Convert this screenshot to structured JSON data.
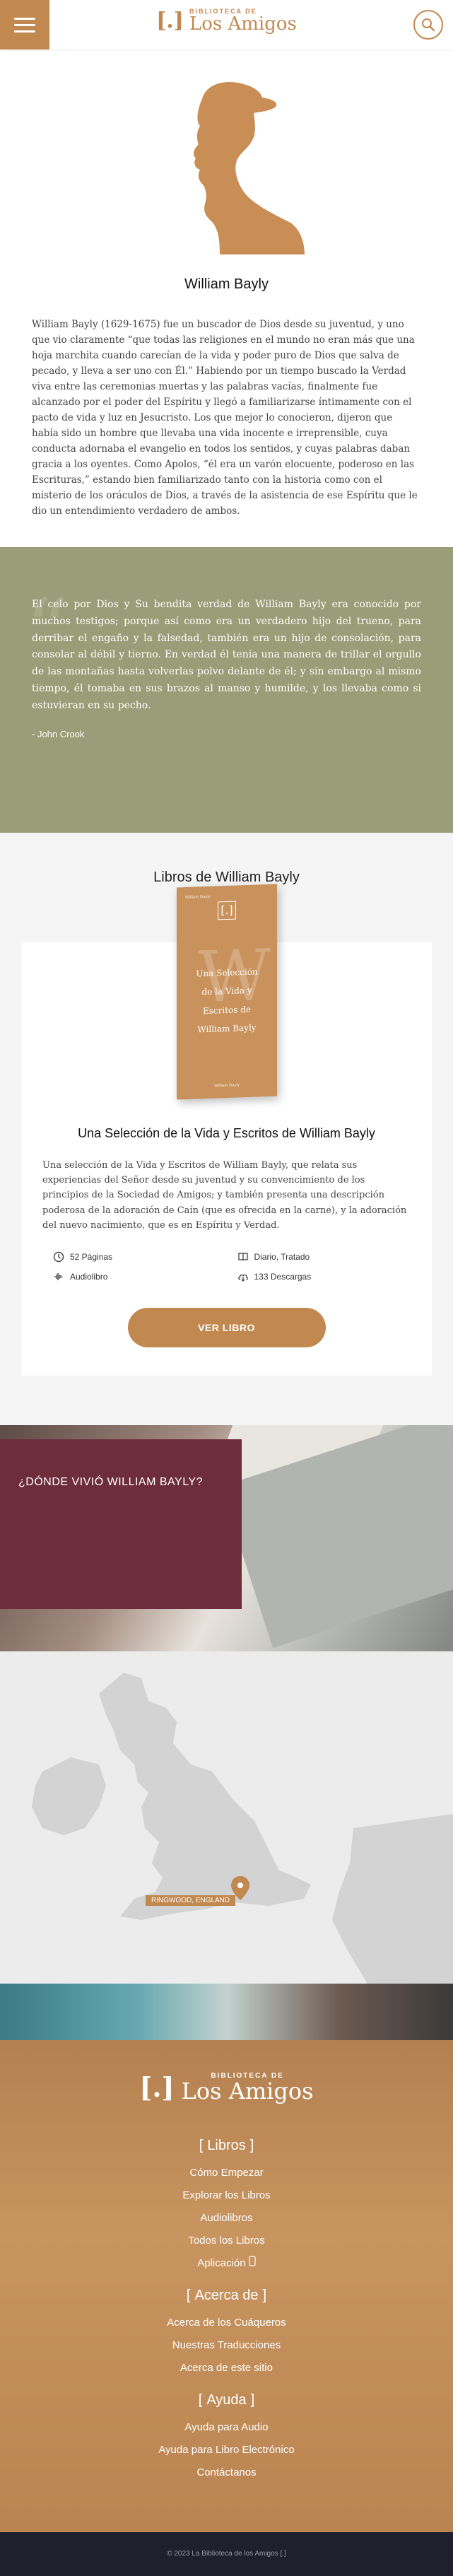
{
  "header": {
    "logo_small": "BIBLIOTECA DE",
    "logo_big": "Los Amigos",
    "logo_mark": "[.]"
  },
  "author": {
    "name": "William Bayly",
    "bio": "William Bayly (1629-1675) fue un buscador de Dios desde su juventud, y uno que vio claramente “que todas las religiones en el mundo no eran más que una hoja marchita cuando carecían de la vida y poder puro de Dios que salva de pecado, y lleva a ser uno con Él.” Habiendo por un tiempo buscado la Verdad viva entre las ceremonias muertas y las palabras vacías, finalmente fue alcanzado por el poder del Espíritu y llegó a familiarizarse íntimamente con el pacto de vida y luz en Jesucristo. Los que mejor lo conocieron, dijeron que había sido un hombre que llevaba una vida inocente e irreprensible, cuya conducta adornaba el evangelio en todos los sentidos, y cuyas palabras daban gracia a los oyentes. Como Apolos, “él era un varón elocuente, poderoso en las Escrituras,” estando bien familiarizado tanto con la historia como con el misterio de los oráculos de Dios, a través de la asistencia de ese Espíritu que le dio un entendimiento verdadero de ambos."
  },
  "quote": {
    "text": "El celo por Dios y Su bendita verdad de William Bayly era conocido por muchos testigos; porque así como era un verdadero hijo del trueno, para derribar el engaño y la falsedad, también era un hijo de consolación, para consolar al débil y tierno. En verdad él tenía una manera de trillar el orgullo de las montañas hasta volverlas polvo delante de él; y sin embargo al mismo tiempo, él tomaba en sus brazos al manso y humilde, y los llevaba como si estuvieran en su pecho.",
    "author": "- John Crook"
  },
  "books": {
    "section_title": "Libros de William Bayly",
    "cover": {
      "top": "William Bayly",
      "line1": "Una Selección",
      "line2": "de la Vida y",
      "line3": "Escritos de",
      "line4": "William Bayly",
      "bottom": "William Bayly",
      "letter": "W"
    },
    "title": "Una Selección de la Vida y Escritos de William Bayly",
    "description": "Una selección de la Vida y Escritos de William Bayly, que relata sus experiencias del Señor desde su juventud y su convencimiento de los principios de la Sociedad de Amigos; y también presenta una descripción poderosa de la adoración de Caín (que es ofrecida en la carne), y la adoración del nuevo nacimiento, que es en Espíritu y Verdad.",
    "pages": "52 Páginas",
    "type": "Diario, Tratado",
    "audio": "Audiolibro",
    "downloads": "133 Descargas",
    "button": "VER LIBRO"
  },
  "lived": {
    "title": "¿DÓNDE VIVIÓ WILLIAM BAYLY?",
    "location": "RINGWOOD, ENGLAND"
  },
  "footer": {
    "logo_small": "BIBLIOTECA DE",
    "logo_big": "Los Amigos",
    "logo_mark": "[.]",
    "groups": [
      {
        "heading": "Libros",
        "links": [
          "Cómo Empezar",
          "Explorar los Libros",
          "Audiolibros",
          "Todos los Libros",
          "Aplicación"
        ]
      },
      {
        "heading": "Acerca de",
        "links": [
          "Acerca de los Cuáqueros",
          "Nuestras Traducciones",
          "Acerca de este sitio"
        ]
      },
      {
        "heading": "Ayuda",
        "links": [
          "Ayuda para Audio",
          "Ayuda para Libro Electrónico",
          "Contáctanos"
        ]
      }
    ],
    "copyright": "© 2023 La Biblioteca de los Amigos [.]"
  },
  "colors": {
    "accent": "#c1884f",
    "olive": "#9a9d77",
    "maroon": "#6d2d3d"
  }
}
